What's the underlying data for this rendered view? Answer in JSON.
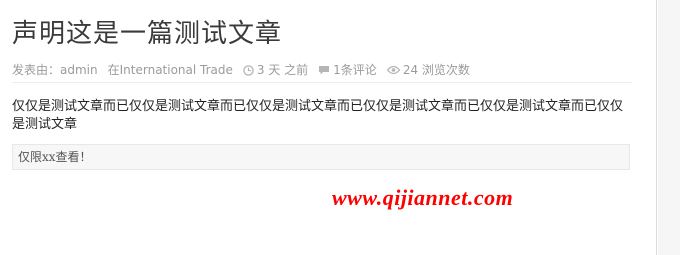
{
  "post": {
    "title": "声明这是一篇测试文章",
    "meta": {
      "posted_by_prefix": "发表由：",
      "author": "admin",
      "category_prefix": "在",
      "category": "International Trade",
      "time_ago": "3 天 之前",
      "comments": "1条评论",
      "views": "24 浏览次数"
    },
    "body": "仅仅是测试文章而已仅仅是测试文章而已仅仅是测试文章而已仅仅是测试文章而已仅仅是测试文章而已仅仅是测试文章",
    "notice": "仅限xx查看！"
  },
  "watermark": "www.qijiannet.com",
  "icons": {
    "clock": "clock-icon",
    "comment": "comment-icon",
    "views": "eye-icon"
  },
  "colors": {
    "watermark": "#ff0000",
    "meta": "#9b9b9b"
  }
}
